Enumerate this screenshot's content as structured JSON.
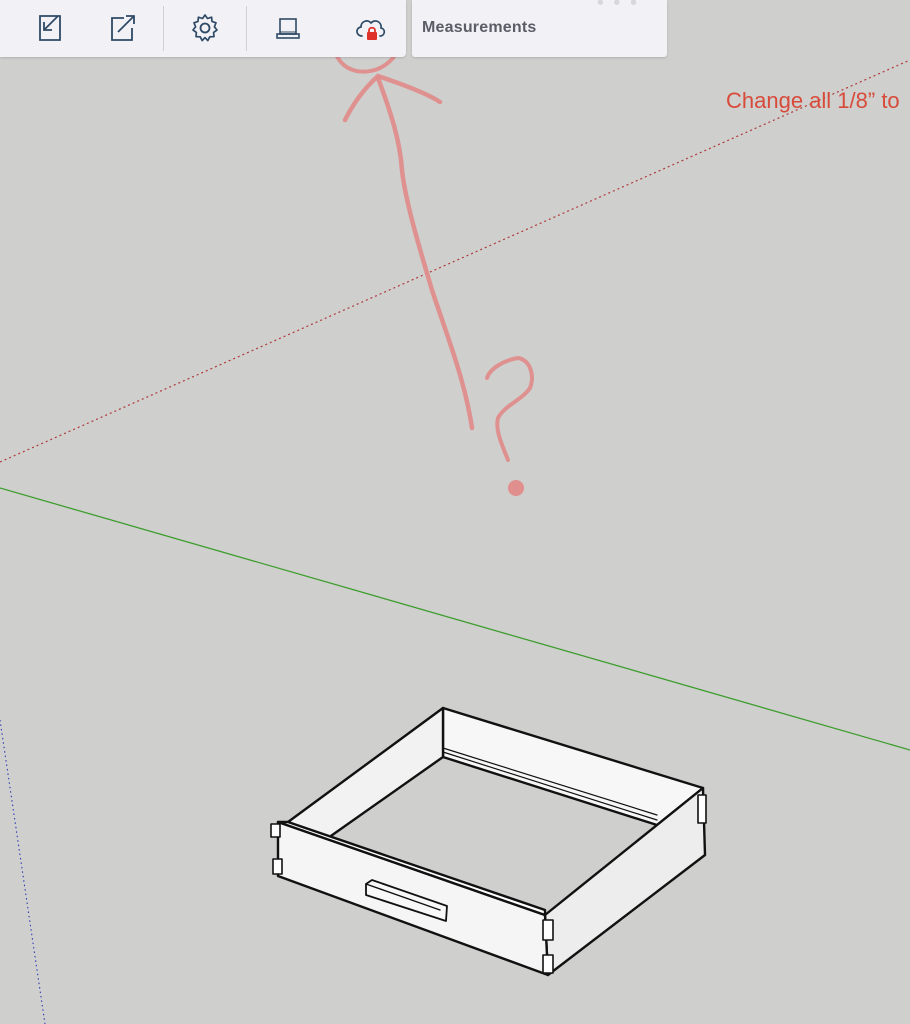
{
  "toolbar": {
    "buttons": [
      {
        "name": "import-button",
        "icon": "import-arrow-icon"
      },
      {
        "name": "export-button",
        "icon": "export-share-icon"
      },
      {
        "name": "settings-button",
        "icon": "gear-icon"
      },
      {
        "name": "device-button",
        "icon": "laptop-icon"
      },
      {
        "name": "cloud-button",
        "icon": "cloud-lock-icon"
      }
    ]
  },
  "panel": {
    "title": "Measurements"
  },
  "annotation": {
    "text": "Change all 1/8” to",
    "color": "#d84a3a",
    "question_mark": "?"
  },
  "colors": {
    "canvas": "#cfcfcd",
    "toolbar": "#f2f2f6",
    "icon": "#2f4a66",
    "lock": "#e0302a",
    "red_axis": "#b03a3a",
    "green_axis": "#3f9e2f",
    "blue_axis": "#2a3fb5",
    "sketch": "#e08a8a"
  }
}
